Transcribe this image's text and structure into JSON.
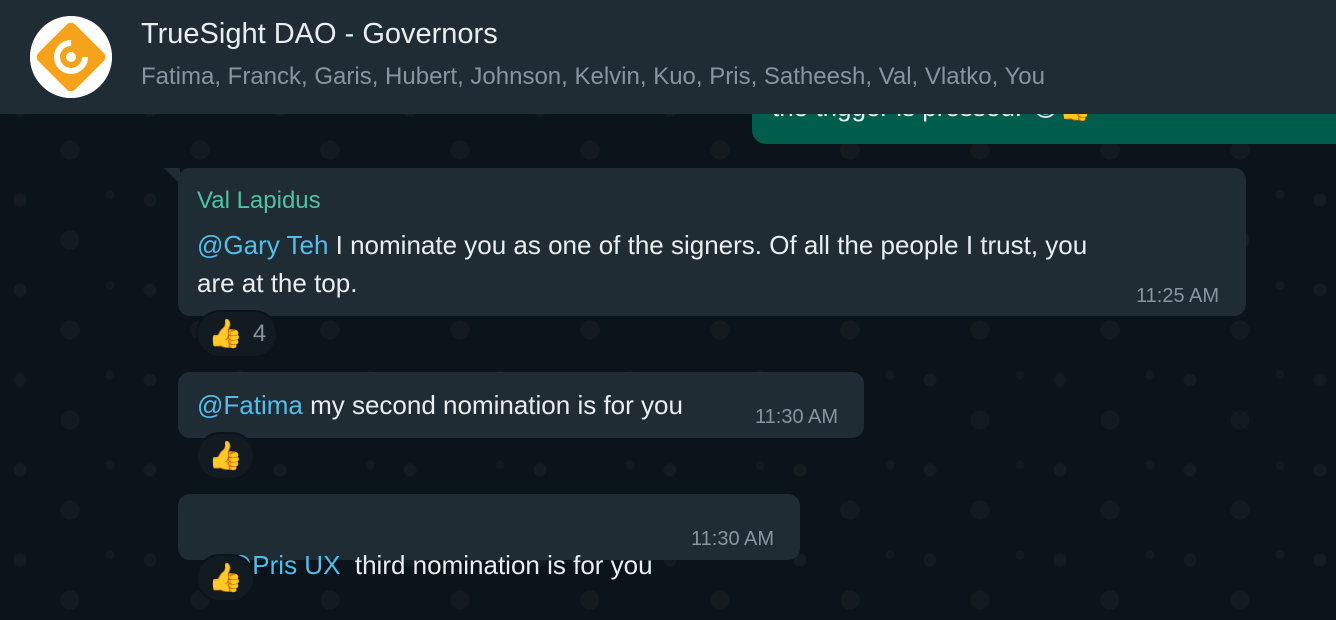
{
  "header": {
    "title": "TrueSight DAO - Governors",
    "members": "Fatima, Franck, Garis, Hubert, Johnson, Kelvin, Kuo, Pris, Satheesh, Val, Vlatko, You",
    "avatar_icon": "truesight-logo-icon",
    "avatar_color": "#f7a21b"
  },
  "outgoing_partial": {
    "text": "the trigger is pressed.",
    "emojis": "😁👍"
  },
  "messages": [
    {
      "sender": "Val Lapidus",
      "mention": "@Gary Teh",
      "text": " I nominate you as one of the signers.  Of all the people I trust, you",
      "text_line2": "are at the top.",
      "time": "11:25 AM",
      "reaction": {
        "emoji": "👍",
        "count": "4"
      }
    },
    {
      "mention": "@Fatima",
      "text": " my second nomination is for you",
      "time": "11:30 AM",
      "reaction": {
        "emoji": "👍"
      }
    },
    {
      "mention": "@Pris UX",
      "text": "  third nomination is for you",
      "time": "11:30 AM",
      "reaction": {
        "emoji": "👍"
      }
    }
  ],
  "colors": {
    "background": "#0b141a",
    "header": "#202c33",
    "incoming_bubble": "#202c33",
    "outgoing_bubble": "#005c4b",
    "mention": "#53bdeb",
    "sender": "#4fc3a1"
  }
}
